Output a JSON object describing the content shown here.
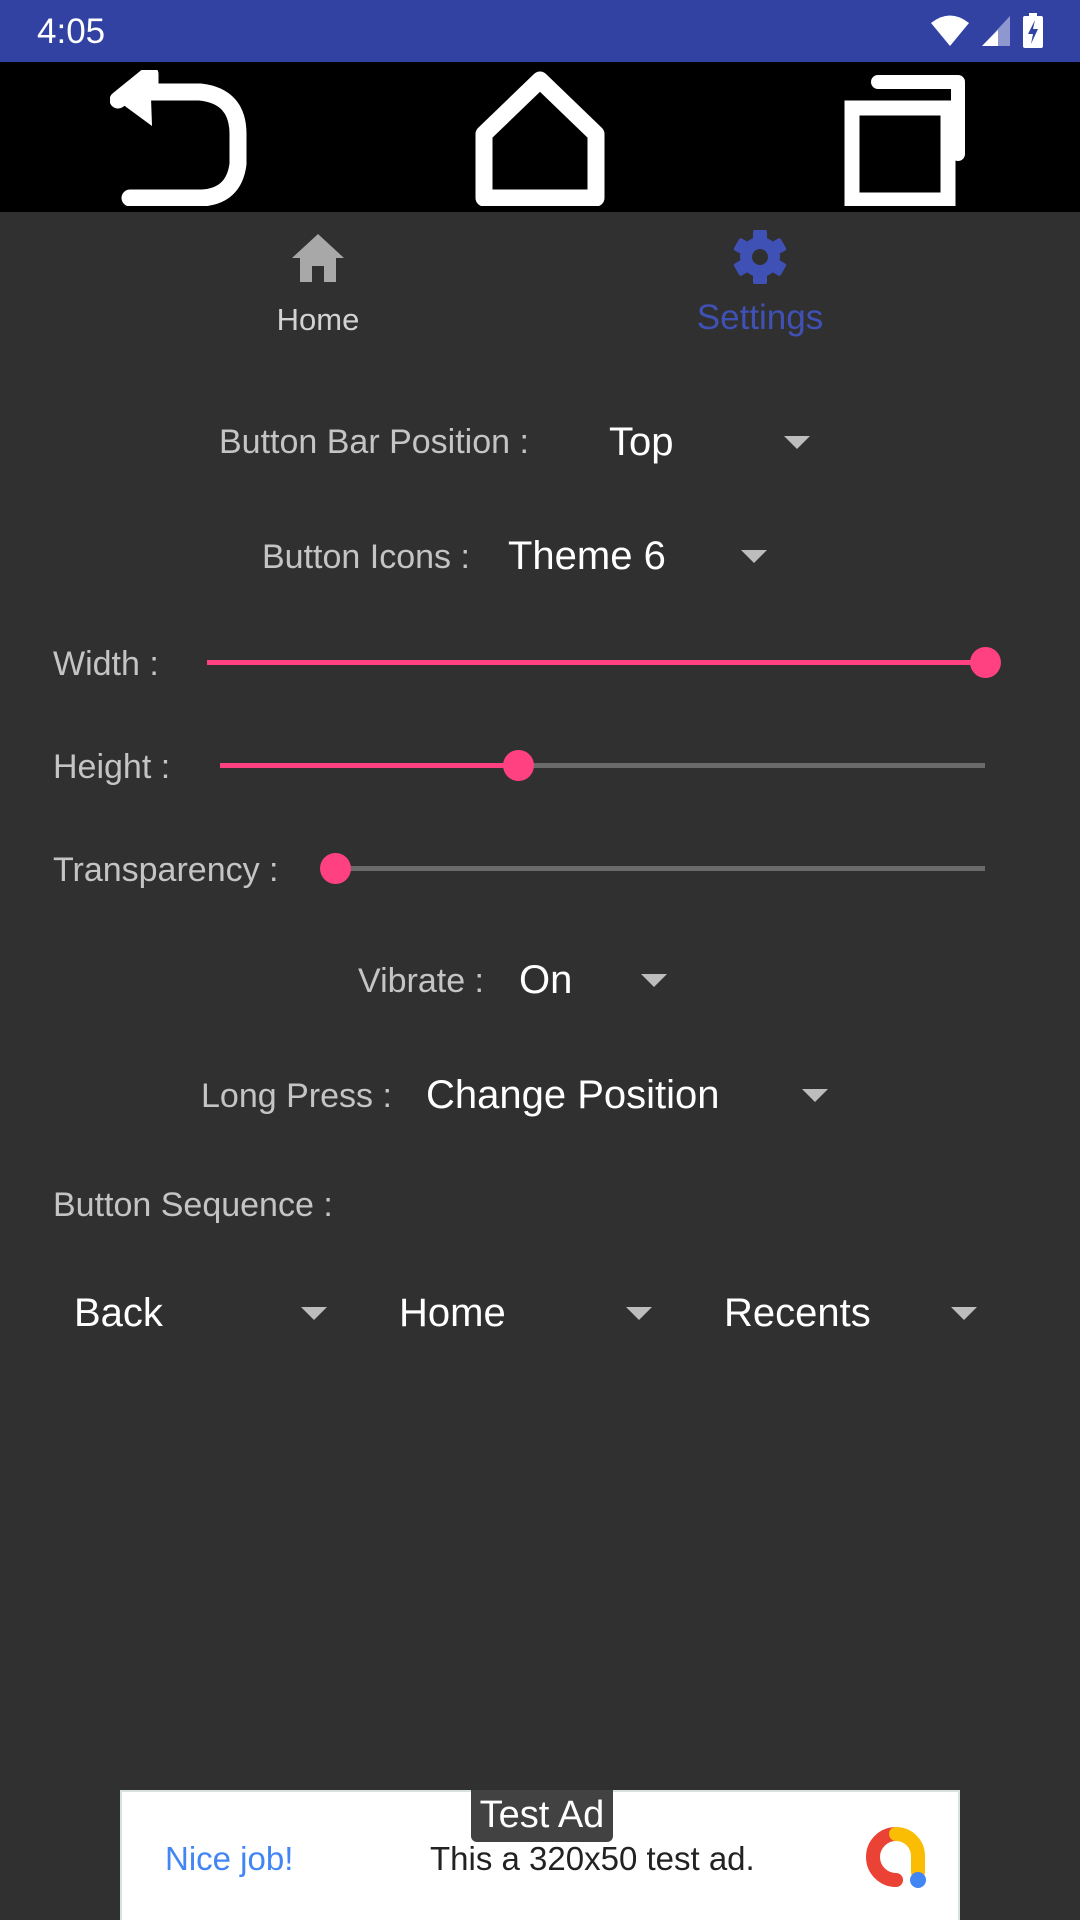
{
  "status_bar": {
    "time": "4:05",
    "icons": [
      "wifi-icon",
      "cell-signal-icon",
      "battery-charging-icon"
    ]
  },
  "nav_bar": {
    "buttons": [
      "back",
      "home",
      "recents"
    ]
  },
  "tabs": [
    {
      "label": "Home",
      "icon": "home-icon",
      "active": false
    },
    {
      "label": "Settings",
      "icon": "gear-icon",
      "active": true
    }
  ],
  "settings": {
    "button_bar_position": {
      "label": "Button Bar Position :",
      "value": "Top"
    },
    "button_icons": {
      "label": "Button Icons :",
      "value": "Theme 6"
    },
    "width": {
      "label": "Width :",
      "value_fraction": 1.0
    },
    "height": {
      "label": "Height :",
      "value_fraction": 0.39
    },
    "transparency": {
      "label": "Transparency :",
      "value_fraction": 0.0
    },
    "vibrate": {
      "label": "Vibrate :",
      "value": "On"
    },
    "long_press": {
      "label": "Long Press :",
      "value": "Change Position"
    },
    "button_sequence": {
      "label": "Button Sequence :",
      "slots": [
        "Back",
        "Home",
        "Recents"
      ]
    }
  },
  "ad": {
    "badge": "Test Ad",
    "headline": "Nice job!",
    "text": "This a 320x50 test ad."
  },
  "colors": {
    "status_bar": "#3242a2",
    "accent": "#3f51b5",
    "slider": "#ff4081",
    "background": "#303030"
  }
}
